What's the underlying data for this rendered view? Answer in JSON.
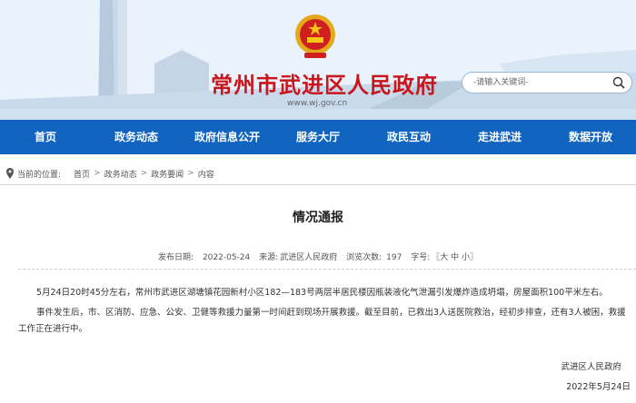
{
  "header": {
    "site_title": "常州市武进区人民政府",
    "site_url": "www.wj.gov.cn",
    "search_placeholder": "-请输入关键词-",
    "emblem_icon": "national-emblem-icon",
    "search_icon": "search-icon"
  },
  "nav": {
    "items": [
      {
        "label": "首页"
      },
      {
        "label": "政务动态"
      },
      {
        "label": "政府信息公开"
      },
      {
        "label": "服务大厅"
      },
      {
        "label": "政民互动"
      },
      {
        "label": "走进武进"
      },
      {
        "label": "数据开放"
      }
    ]
  },
  "breadcrumb": {
    "prefix": "当前的位置:",
    "items": [
      "首页",
      "政务动态",
      "政务要闻",
      "内容"
    ],
    "separator": ">"
  },
  "article": {
    "title": "情况通报",
    "meta": {
      "date_label": "发布日期:",
      "date": "2022-05-24",
      "source_label": "来源:",
      "source": "武进区人民政府",
      "views_label": "浏览次数:",
      "views": "197",
      "fontsize_label": "字号:",
      "fontsize_options": "〖大 中 小〗"
    },
    "paragraphs": [
      "5月24日20时45分左右，常州市武进区湖塘镇花园新村小区182—183号两层半居民楼因瓶装液化气泄漏引发爆炸造成坍塌，房屋面积100平米左右。",
      "事件发生后，市、区消防、应急、公安、卫健等救援力量第一时间赶到现场开展救援。截至目前，已救出3人送医院救治，经初步排查，还有3人被困，救援工作正在进行中。"
    ],
    "signature": "武进区人民政府",
    "sign_date": "2022年5月24日"
  },
  "colors": {
    "nav_bg": "#1164c0",
    "title_red": "#c8161d"
  }
}
